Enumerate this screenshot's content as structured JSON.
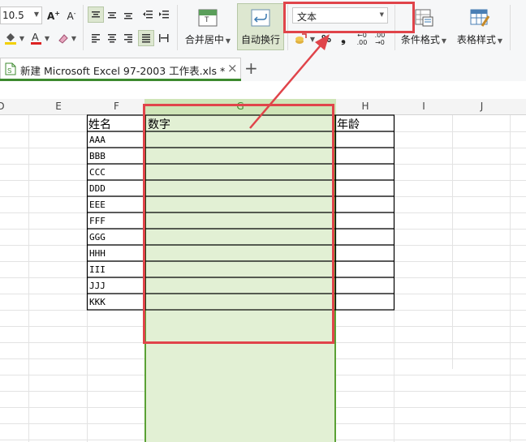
{
  "ribbon": {
    "font_size_value": "10.5",
    "merge_center_label": "合并居中",
    "wrap_text_label": "自动换行",
    "number_format_value": "文本",
    "percent_symbol": "%",
    "comma_symbol": "❟",
    "conditional_format_label": "条件格式",
    "table_style_label": "表格样式",
    "inc_decimal": ".00",
    "dec_decimal": ".00"
  },
  "tabs": {
    "file_tab_label": "新建 Microsoft Excel 97-2003 工作表.xls *",
    "close_symbol": "×",
    "add_symbol": "+"
  },
  "sheet": {
    "columns": [
      "D",
      "E",
      "F",
      "G",
      "H",
      "I",
      "J"
    ],
    "header_f": "姓名",
    "header_g": "数字",
    "header_h": "年龄",
    "names": [
      "AAA",
      "BBB",
      "CCC",
      "DDD",
      "EEE",
      "FFF",
      "GGG",
      "HHH",
      "III",
      "JJJ",
      "KKK"
    ]
  },
  "colors": {
    "selection_fill": "#e2f0d4",
    "selection_border": "#5aa134",
    "highlight_red": "#e0444a",
    "accent_green": "#3d8a2f"
  }
}
